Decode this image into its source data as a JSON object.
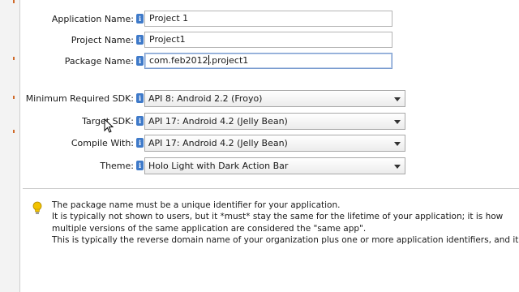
{
  "form": {
    "application_name": {
      "label": "Application Name:",
      "value": "Project 1"
    },
    "project_name": {
      "label": "Project Name:",
      "value": "Project1"
    },
    "package_name": {
      "label": "Package Name:",
      "value_before_caret": "com.feb2012",
      "value_after_caret": ".project1"
    },
    "min_sdk": {
      "label": "Minimum Required SDK:",
      "value": "API 8: Android 2.2 (Froyo)"
    },
    "target_sdk": {
      "label": "Target SDK:",
      "value": "API 17: Android 4.2 (Jelly Bean)"
    },
    "compile_with": {
      "label": "Compile With:",
      "value": "API 17: Android 4.2 (Jelly Bean)"
    },
    "theme": {
      "label": "Theme:",
      "value": "Holo Light with Dark Action Bar"
    }
  },
  "info_icon_glyph": "i",
  "help": {
    "icon": "lightbulb-icon",
    "lines": [
      "The package name must be a unique identifier for your application.",
      "It is typically not shown to users, but it *must* stay the same for the lifetime of your application; it is how",
      "multiple versions of the same application are considered the \"same app\".",
      "This is typically the reverse domain name of your organization plus one or more application identifiers, and it"
    ]
  },
  "colors": {
    "info_icon": "#3f7ac9",
    "left_accent": "#d06a2a",
    "bulb": "#f2c200"
  }
}
